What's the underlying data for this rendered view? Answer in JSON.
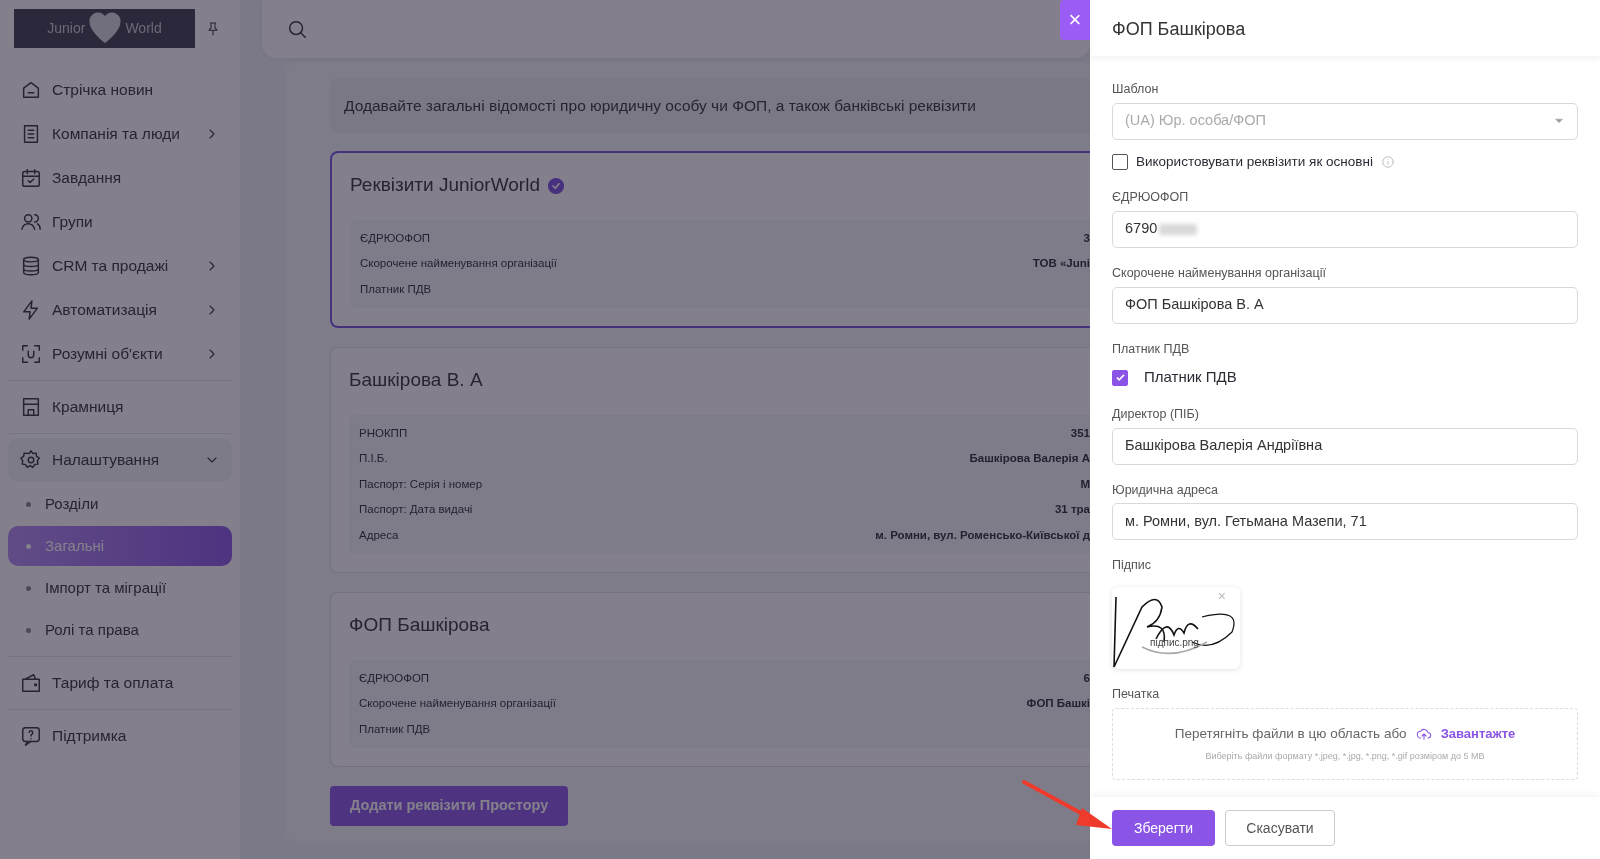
{
  "logo": {
    "left": "Junior",
    "right": "World"
  },
  "sidebar": {
    "sections": [
      {
        "items": [
          {
            "label": "Стрічка новин",
            "expandable": false
          },
          {
            "label": "Компанія та люди",
            "expandable": true,
            "expanded": false
          },
          {
            "label": "Завдання",
            "expandable": false
          },
          {
            "label": "Групи",
            "expandable": false
          },
          {
            "label": "CRM та продажі",
            "expandable": true,
            "expanded": false
          },
          {
            "label": "Автоматизація",
            "expandable": true,
            "expanded": false
          },
          {
            "label": "Розумні об'єкти",
            "expandable": true,
            "expanded": false
          }
        ]
      },
      {
        "items": [
          {
            "label": "Крамниця",
            "expandable": false
          }
        ]
      },
      {
        "items": [
          {
            "label": "Налаштування",
            "expandable": true,
            "expanded": true,
            "children": [
              {
                "label": "Розділи",
                "selected": false
              },
              {
                "label": "Загальні",
                "selected": true
              },
              {
                "label": "Імпорт та міграції",
                "selected": false
              },
              {
                "label": "Ролі та права",
                "selected": false
              }
            ]
          }
        ]
      },
      {
        "items": [
          {
            "label": "Тариф та оплата",
            "expandable": false
          }
        ]
      },
      {
        "items": [
          {
            "label": "Підтримка",
            "expandable": false
          }
        ]
      }
    ]
  },
  "description": "Додавайте загальні відомості про юридичну особу чи ФОП, а також банківські реквізити",
  "cards": [
    {
      "title": "Реквізити JuniorWorld",
      "primary": true,
      "rows": [
        {
          "label": "ЄДРЮОФОП",
          "value": "3"
        },
        {
          "label": "Скорочене найменування організації",
          "value": "ТОВ «Juni"
        },
        {
          "label": "Платник ПДВ"
        }
      ]
    },
    {
      "title": "Башкірова В. А",
      "primary": false,
      "rows": [
        {
          "label": "РНОКПП",
          "value": "351"
        },
        {
          "label": "П.І.Б.",
          "value": "Башкірова Валерія А"
        },
        {
          "label": "Паспорт: Серія і номер",
          "value": "М"
        },
        {
          "label": "Паспорт: Дата видачі",
          "value": "31 тра"
        },
        {
          "label": "Адреса",
          "value": "м. Ромни, вул. Роменсько-Київської д"
        }
      ]
    },
    {
      "title": "ФОП Башкірова",
      "primary": false,
      "rows": [
        {
          "label": "ЄДРЮОФОП",
          "value": "6"
        },
        {
          "label": "Скорочене найменування організації",
          "value": "ФОП Башкі"
        },
        {
          "label": "Платник ПДВ"
        }
      ]
    }
  ],
  "add_button": "Додати реквізити Простору",
  "drawer": {
    "title": "ФОП Башкірова",
    "template": {
      "label": "Шаблон",
      "value": "(UA) Юр. особа/ФОП",
      "disabled": true
    },
    "use_as_main": {
      "label": "Використовувати реквізити як основні",
      "checked": false
    },
    "fields": [
      {
        "kind": "text",
        "label": "ЄДРЮОФОП",
        "value": "6790",
        "redacted": true
      },
      {
        "kind": "text",
        "label": "Скорочене найменування організації",
        "value": "ФОП Башкірова В. А"
      },
      {
        "kind": "checkbox",
        "label": "Платник ПДВ",
        "option": "Платник ПДВ",
        "checked": true
      },
      {
        "kind": "text",
        "label": "Директор (ПІБ)",
        "value": "Башкірова Валерія Андріївна"
      },
      {
        "kind": "text",
        "label": "Юридична адреса",
        "value": "м. Ромни, вул. Гетьмана Мазепи, 71"
      },
      {
        "kind": "image",
        "label": "Підпис",
        "file": "підпис.png",
        "remove": "×"
      },
      {
        "kind": "upload",
        "label": "Печатка",
        "prompt": "Перетягніть файли в цю область або",
        "link": "Завантажте",
        "hint": "Виберіть файли формату *.jpeg, *.jpg, *.png, *.gif розміром до 5 MB"
      }
    ],
    "buttons": [
      {
        "label": "Зберегти",
        "primary": true
      },
      {
        "label": "Скасувати",
        "primary": false
      }
    ]
  },
  "close_button": "×",
  "annotation_arrow": {
    "color": "#ee3b2b"
  }
}
